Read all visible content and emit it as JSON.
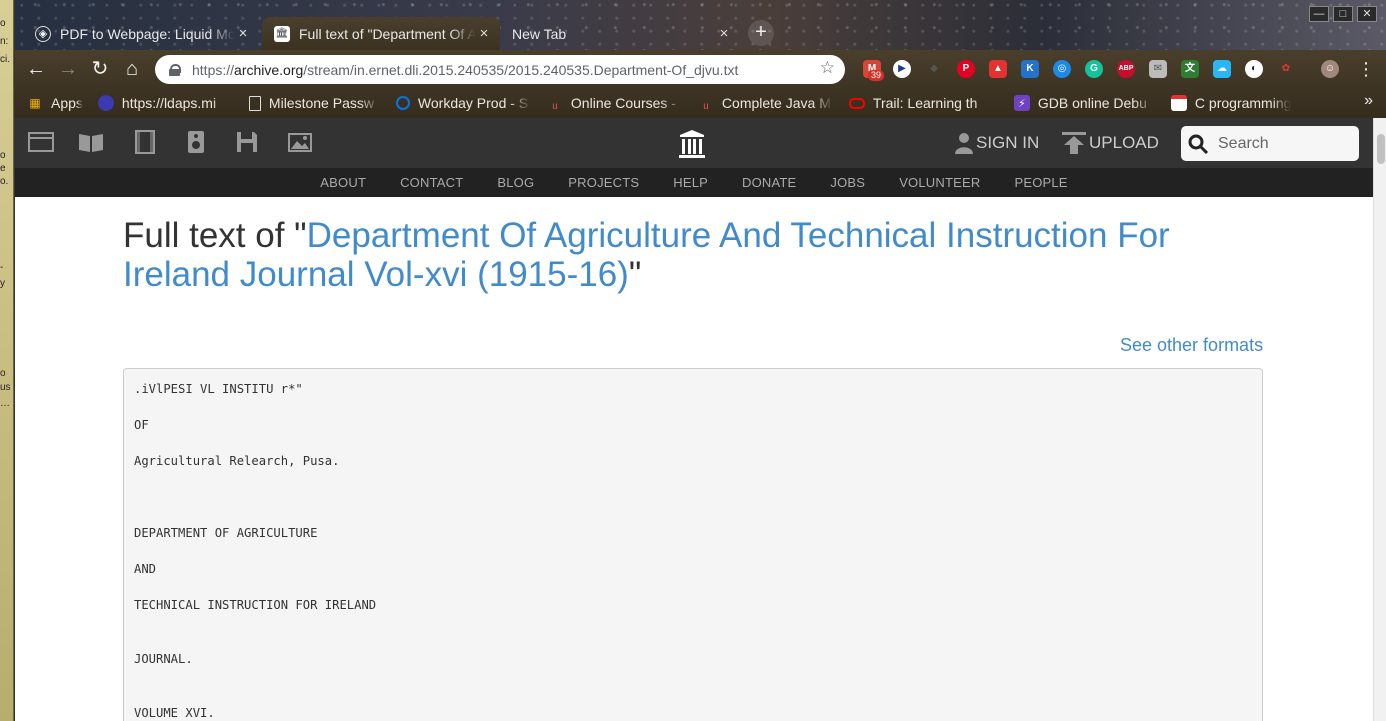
{
  "browser": {
    "tabs": [
      {
        "title": "PDF to Webpage: Liquid Mode",
        "favicon": "adobe-icon",
        "active": false
      },
      {
        "title": "Full text of \"Department Of Agriculture\"",
        "favicon": "archive-icon",
        "active": true
      },
      {
        "title": "New Tab",
        "favicon": "",
        "active": false
      }
    ],
    "new_tab": "+",
    "window_controls": {
      "minimize": "—",
      "maximize": "□",
      "close": "✕"
    },
    "nav": {
      "back": "←",
      "forward": "→",
      "reload": "↻",
      "home": "⌂"
    },
    "url": {
      "scheme": "https://",
      "host": "archive.org",
      "path": "/stream/in.ernet.dli.2015.240535/2015.240535.Department-Of_djvu.txt"
    },
    "bookmark_star": "☆",
    "extension_badge": "39",
    "bookmarks": [
      {
        "label": "Apps",
        "icon": "apps-grid-icon",
        "color": "#4285f4"
      },
      {
        "label": "https://ldaps.mi",
        "icon": "globe-icon",
        "color": "#3b3bb0"
      },
      {
        "label": "Milestone Passw",
        "icon": "page-icon",
        "color": "#dddddd"
      },
      {
        "label": "Workday Prod - S",
        "icon": "workday-icon",
        "color": "#0875e1"
      },
      {
        "label": "Online Courses -",
        "icon": "udemy-icon",
        "color": "#ec5252"
      },
      {
        "label": "Complete Java M",
        "icon": "udemy-icon",
        "color": "#ec5252"
      },
      {
        "label": "Trail: Learning th",
        "icon": "oracle-icon",
        "color": "#f80000"
      },
      {
        "label": "GDB online Debu",
        "icon": "bolt-icon",
        "color": "#6f42c1"
      },
      {
        "label": "C programming",
        "icon": "book-icon",
        "color": "#e23232"
      }
    ],
    "bookmarks_more": "»"
  },
  "site": {
    "actions": {
      "sign_in": "SIGN IN",
      "upload": "UPLOAD"
    },
    "search": {
      "placeholder": "Search"
    },
    "nav_links": [
      "ABOUT",
      "CONTACT",
      "BLOG",
      "PROJECTS",
      "HELP",
      "DONATE",
      "JOBS",
      "VOLUNTEER",
      "PEOPLE"
    ]
  },
  "page": {
    "heading_prefix": "Full text of \"",
    "item_title": "Department Of Agriculture And Technical Instruction For Ireland Journal Vol-xvi (1915-16)",
    "heading_suffix": "\"",
    "other_formats": "See other formats",
    "fulltext": ".iVlPESI VL INSTITU r*\"\n\nOF\n\nAgricultural Relearch, Pusa.\n\n\n\nDEPARTMENT OF AGRICULTURE\n\nAND\n\nTECHNICAL INSTRUCTION FOR IRELAND\n\n\nJOURNAL.\n\n\nVOLUME XVI."
  }
}
